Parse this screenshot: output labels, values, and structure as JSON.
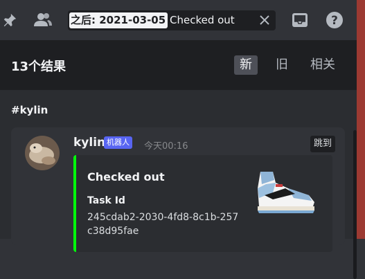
{
  "header": {
    "filter_chip": "之后: 2021-03-05",
    "query": "Checked out"
  },
  "results": {
    "count_label": "13个结果",
    "sort_options": [
      "新",
      "旧",
      "相关"
    ]
  },
  "message": {
    "channel": "#kylin",
    "author": "kylin",
    "bot_tag": "机器人",
    "timestamp": "今天00:16",
    "jump_label": "跳到",
    "embed": {
      "title": "Checked out",
      "field_name": "Task Id",
      "field_value": "245cdab2-2030-4fd8-8c1b-257c38d95fae",
      "accent_color": "#00ff0a"
    }
  },
  "icons": [
    "pin-icon",
    "members-icon",
    "close-icon",
    "inbox-icon",
    "help-icon"
  ]
}
